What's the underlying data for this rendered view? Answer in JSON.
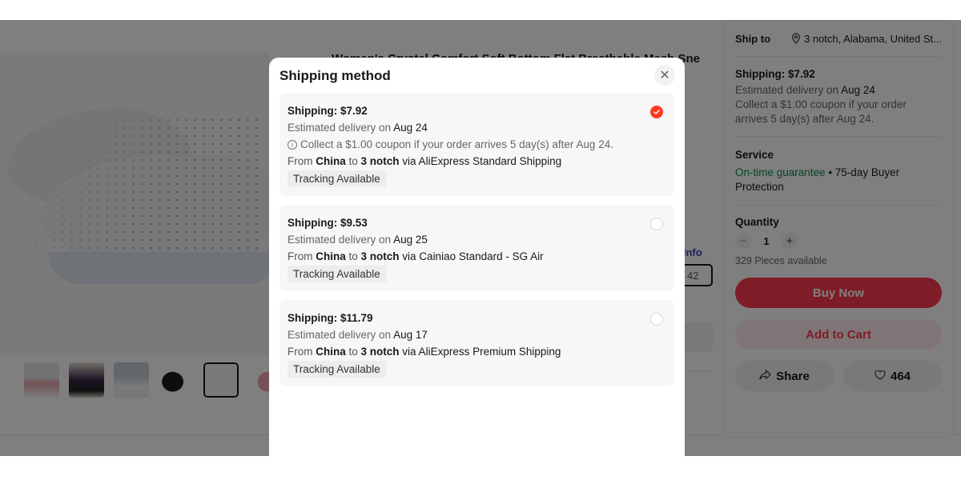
{
  "product": {
    "title": "Women's Crystal Comfort Soft Bottom Flat Breathable Mesh Sneakers",
    "more_info_link": "e Info",
    "size_value": "42",
    "thumbnails": [
      "thumbnail-pink-sneakers",
      "thumbnail-black-sneakers-worn",
      "thumbnail-white-sneakers-worn",
      "thumbnail-black-sneaker",
      "thumbnail-white-sneaker",
      "thumbnail-pink-sneaker"
    ],
    "selected_thumbnail_index": 4
  },
  "sidebar": {
    "ship_to_label": "Ship to",
    "ship_to_address": "3 notch, Alabama, United St...",
    "shipping_price": "Shipping: $7.92",
    "estimated_prefix": "Estimated delivery on",
    "estimated_date": "Aug 24",
    "coupon_note": "Collect a $1.00 coupon if your order arrives 5 day(s) after Aug 24.",
    "service_title": "Service",
    "service_guarantee": "On-time guarantee",
    "service_protection": " • 75-day Buyer Protection",
    "quantity_title": "Quantity",
    "quantity_value": "1",
    "minus_symbol": "−",
    "plus_symbol": "+",
    "stock_text": "329 Pieces available",
    "buy_now_label": "Buy Now",
    "add_to_cart_label": "Add to Cart",
    "share_label": "Share",
    "wishlist_count": "464"
  },
  "modal": {
    "title": "Shipping method",
    "close_symbol": "✕",
    "options": [
      {
        "price": "Shipping: $7.92",
        "est_prefix": "Estimated delivery on ",
        "est_date": "Aug 24",
        "coupon": "Collect a $1.00 coupon if your order arrives 5 day(s) after Aug 24.",
        "from_word": "From ",
        "origin": "China",
        "to_word": " to ",
        "destination": "3 notch",
        "via": " via AliExpress Standard Shipping",
        "tag": "Tracking Available",
        "selected": true
      },
      {
        "price": "Shipping: $9.53",
        "est_prefix": "Estimated delivery on ",
        "est_date": "Aug 25",
        "from_word": "From ",
        "origin": "China",
        "to_word": " to ",
        "destination": "3 notch",
        "via": " via Cainiao Standard - SG Air",
        "tag": "Tracking Available",
        "selected": false
      },
      {
        "price": "Shipping: $11.79",
        "est_prefix": "Estimated delivery on ",
        "est_date": "Aug 17",
        "from_word": "From ",
        "origin": "China",
        "to_word": " to ",
        "destination": "3 notch",
        "via": " via AliExpress Premium Shipping",
        "tag": "Tracking Available",
        "selected": false
      }
    ]
  },
  "colors": {
    "accent_red": "#fd384f",
    "radio_selected": "#fd3a1e",
    "guarantee_green": "#0a8a4a",
    "link_blue": "#2e48c4"
  }
}
